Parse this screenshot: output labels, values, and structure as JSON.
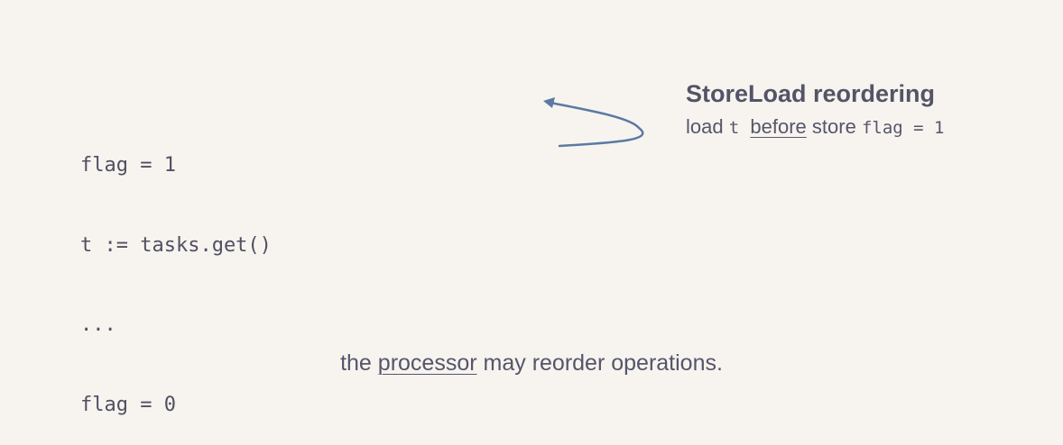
{
  "code": {
    "lines": [
      "flag = 1",
      "t := tasks.get()",
      "...",
      "flag = 0"
    ]
  },
  "annotation": {
    "title": "StoreLoad reordering",
    "load_word": "load",
    "load_var": "t",
    "before_word": "before",
    "store_word": "store",
    "store_expr": "flag = 1"
  },
  "caption": {
    "prefix": "the",
    "emphasis": "processor",
    "suffix": "may reorder operations."
  },
  "colors": {
    "background": "#f7f4ef",
    "arrow": "#5a7aa3",
    "text": "#55556a"
  },
  "icons": [
    "curved-arrow-icon"
  ]
}
